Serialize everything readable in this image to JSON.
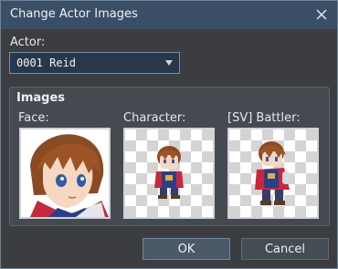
{
  "window": {
    "title": "Change Actor Images"
  },
  "actor": {
    "label": "Actor:",
    "selected": "0001 Reid"
  },
  "images": {
    "group_title": "Images",
    "face_label": "Face:",
    "character_label": "Character:",
    "battler_label": "[SV] Battler:"
  },
  "buttons": {
    "ok": "OK",
    "cancel": "Cancel"
  },
  "icons": {
    "close": "close-icon",
    "dropdown": "chevron-down-icon"
  }
}
